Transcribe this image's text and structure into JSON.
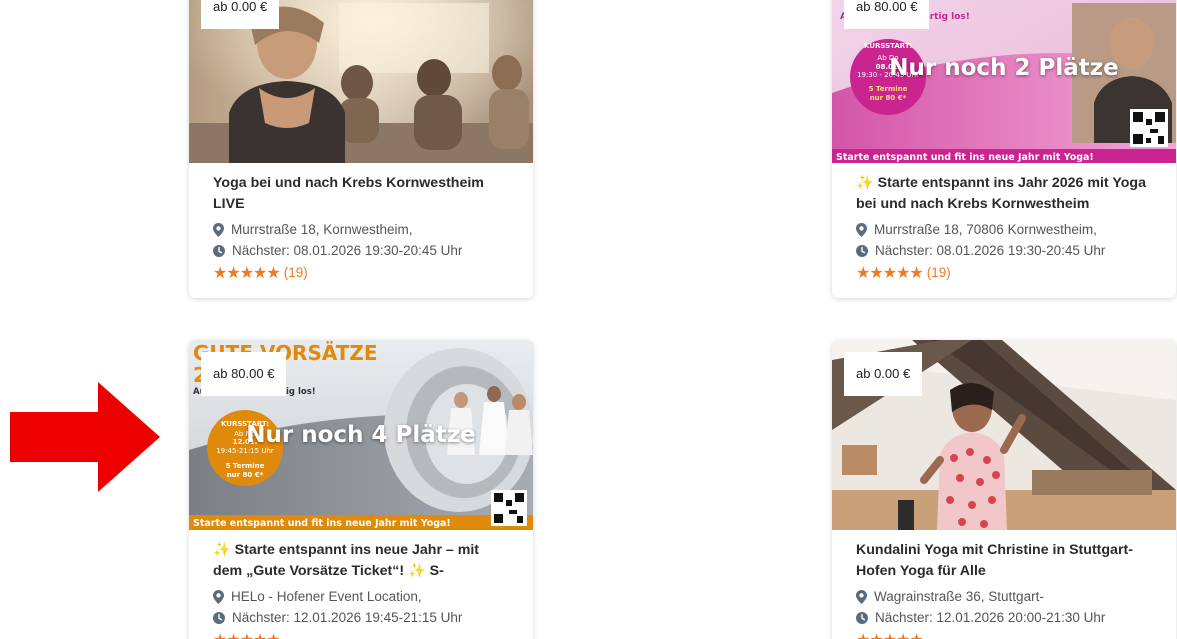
{
  "cards": [
    {
      "price": "ab 0.00 €",
      "overlay": "",
      "title": "Yoga bei und nach Krebs Kornwestheim LIVE",
      "spark_prefix": "",
      "address": "Murrstraße 18, Kornwestheim,",
      "next_date": "Nächster: 08.01.2026 19:30-20:45 Uhr",
      "stars": "★★★★★",
      "rating_count": "(19)"
    },
    {
      "price": "ab 80.00 €",
      "overlay": "Nur noch 2 Plätze",
      "title": "Starte entspannt ins Jahr 2026 mit Yoga bei und nach Krebs Kornwestheim",
      "spark_prefix": "✨",
      "address": "Murrstraße 18, 70806 Kornwestheim,",
      "next_date": "Nächster: 08.01.2026 19:30-20:45 Uhr",
      "stars": "★★★★★",
      "rating_count": "(19)",
      "poster": {
        "headline_sub": "Auf die Matte – fertig los!",
        "kursstart": "KURSSTART:",
        "kurs_line1": "Ab Do",
        "kurs_line2": "08.01.",
        "kurs_line3": "19:30 - 20:45 Uhr",
        "termine": "5 Termine",
        "preis": "nur 80 €*",
        "footer": "Starte entspannt und fit ins neue Jahr mit Yoga!"
      }
    },
    {
      "price": "ab 80.00 €",
      "overlay": "Nur noch 4 Plätze",
      "title": "Starte entspannt ins neue Jahr – mit dem „Gute Vorsätze Ticket“! ✨ S-",
      "spark_prefix": "✨",
      "address": "HELo - Hofener Event Location,",
      "next_date": "Nächster: 12.01.2026 19:45-21:15 Uhr",
      "stars": "★★★★★",
      "rating_count": "",
      "poster": {
        "headline": "GUTE VORSÄTZE",
        "headline2": "2026",
        "headline_sub": "Auf die Matte – fertig los!",
        "kursstart": "KURSSTART:",
        "kurs_line1": "Ab Mo",
        "kurs_line2": "12.01.",
        "kurs_line3": "19:45-21:15 Uhr",
        "termine": "5 Termine",
        "preis": "nur 80 €*",
        "footer": "Starte entspannt und fit ins neue Jahr mit Yoga!"
      }
    },
    {
      "price": "ab 0.00 €",
      "overlay": "",
      "title": "Kundalini Yoga mit Christine in Stuttgart-Hofen Yoga für Alle",
      "spark_prefix": "",
      "address": "Wagrainstraße 36, Stuttgart-",
      "next_date": "Nächster: 12.01.2026 20:00-21:30 Uhr",
      "stars": "★★★★★",
      "rating_count": ""
    }
  ],
  "colors": {
    "accent_orange": "#ef7a24",
    "poster_magenta": "#c9248f",
    "poster_orange": "#e08a0c",
    "arrow_red": "#ee0000"
  },
  "icons": {
    "location": "map-marker-icon",
    "clock": "clock-icon",
    "arrow": "arrow-right-icon",
    "qr": "qr-code-icon"
  }
}
